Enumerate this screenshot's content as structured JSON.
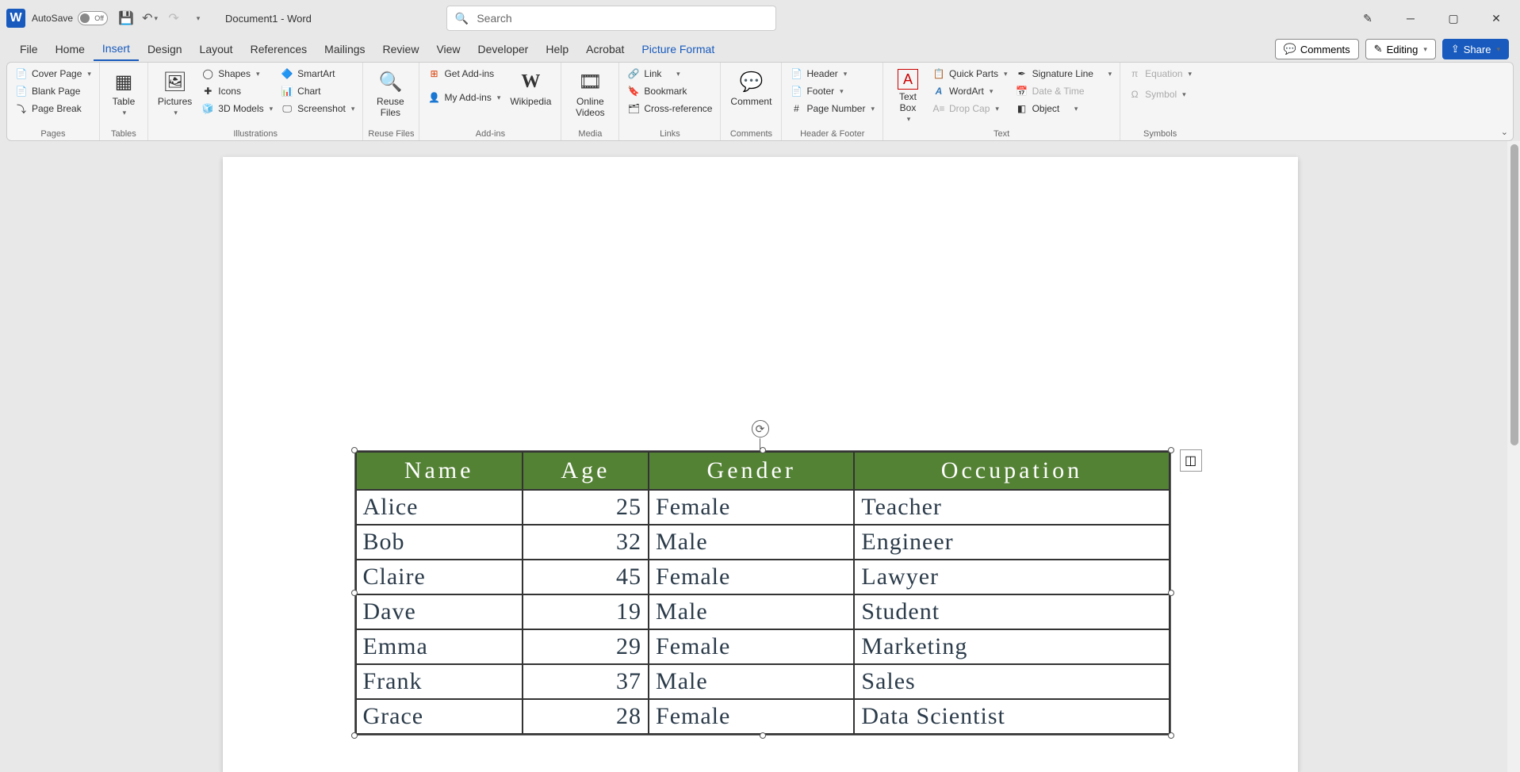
{
  "title_bar": {
    "app_letter": "W",
    "autosave_label": "AutoSave",
    "autosave_state": "Off",
    "doc_title": "Document1  -  Word",
    "search_placeholder": "Search"
  },
  "tabs": {
    "file": "File",
    "home": "Home",
    "insert": "Insert",
    "design": "Design",
    "layout": "Layout",
    "references": "References",
    "mailings": "Mailings",
    "review": "Review",
    "view": "View",
    "developer": "Developer",
    "help": "Help",
    "acrobat": "Acrobat",
    "picture_format": "Picture Format"
  },
  "right_actions": {
    "comments": "Comments",
    "editing": "Editing",
    "share": "Share"
  },
  "ribbon": {
    "pages": {
      "cover_page": "Cover Page",
      "blank_page": "Blank Page",
      "page_break": "Page Break",
      "label": "Pages"
    },
    "tables": {
      "table": "Table",
      "label": "Tables"
    },
    "illustrations": {
      "pictures": "Pictures",
      "shapes": "Shapes",
      "icons": "Icons",
      "models": "3D Models",
      "smartart": "SmartArt",
      "chart": "Chart",
      "screenshot": "Screenshot",
      "label": "Illustrations"
    },
    "reuse": {
      "reuse_files": "Reuse Files",
      "label": "Reuse Files"
    },
    "addins": {
      "get": "Get Add-ins",
      "my": "My Add-ins",
      "wikipedia": "Wikipedia",
      "label": "Add-ins"
    },
    "media": {
      "online_videos": "Online Videos",
      "label": "Media"
    },
    "links": {
      "link": "Link",
      "bookmark": "Bookmark",
      "crossref": "Cross-reference",
      "label": "Links"
    },
    "comments": {
      "comment": "Comment",
      "label": "Comments"
    },
    "headerfooter": {
      "header": "Header",
      "footer": "Footer",
      "page_number": "Page Number",
      "label": "Header & Footer"
    },
    "text": {
      "text_box": "Text Box",
      "quick_parts": "Quick Parts",
      "wordart": "WordArt",
      "drop_cap": "Drop Cap",
      "sig_line": "Signature Line",
      "date_time": "Date & Time",
      "object": "Object",
      "label": "Text"
    },
    "symbols": {
      "equation": "Equation",
      "symbol": "Symbol",
      "label": "Symbols"
    }
  },
  "table_data": {
    "headers": [
      "Name",
      "Age",
      "Gender",
      "Occupation"
    ],
    "rows": [
      {
        "name": "Alice",
        "age": "25",
        "gender": "Female",
        "occupation": "Teacher"
      },
      {
        "name": "Bob",
        "age": "32",
        "gender": "Male",
        "occupation": "Engineer"
      },
      {
        "name": "Claire",
        "age": "45",
        "gender": "Female",
        "occupation": "Lawyer"
      },
      {
        "name": "Dave",
        "age": "19",
        "gender": "Male",
        "occupation": "Student"
      },
      {
        "name": "Emma",
        "age": "29",
        "gender": "Female",
        "occupation": "Marketing"
      },
      {
        "name": "Frank",
        "age": "37",
        "gender": "Male",
        "occupation": "Sales"
      },
      {
        "name": "Grace",
        "age": "28",
        "gender": "Female",
        "occupation": "Data Scientist"
      }
    ]
  }
}
